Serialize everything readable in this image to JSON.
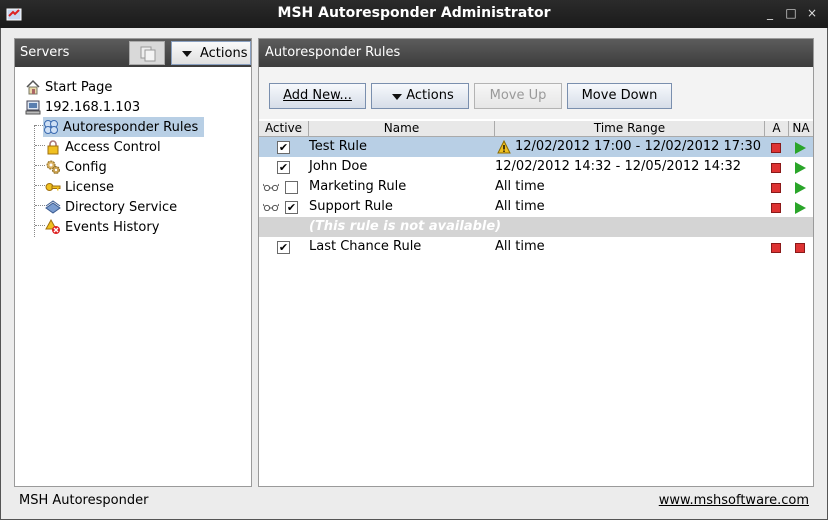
{
  "window": {
    "title": "MSH Autoresponder Administrator",
    "controls": [
      "_",
      "□",
      "×"
    ]
  },
  "servers_panel": {
    "title": "Servers",
    "actions_label": "Actions",
    "tree": [
      {
        "label": "Start Page",
        "icon": "home-icon"
      },
      {
        "label": "192.168.1.103",
        "icon": "computer-icon"
      },
      {
        "label": "Autoresponder Rules",
        "icon": "rules-icon",
        "selected": true
      },
      {
        "label": "Access Control",
        "icon": "lock-icon"
      },
      {
        "label": "Config",
        "icon": "gear-icon"
      },
      {
        "label": "License",
        "icon": "key-icon"
      },
      {
        "label": "Directory Service",
        "icon": "directory-icon"
      },
      {
        "label": "Events History",
        "icon": "events-icon"
      }
    ]
  },
  "rules_panel": {
    "title": "Autoresponder Rules",
    "buttons": {
      "add_new": "Add New...",
      "actions": "Actions",
      "move_up": "Move Up",
      "move_down": "Move Down"
    },
    "columns": [
      "Active",
      "Name",
      "Time Range",
      "A",
      "NA"
    ],
    "rows": [
      {
        "active": "✔",
        "name": "Test Rule",
        "time": "12/02/2012 17:00 - 12/02/2012 17:30",
        "warning": true,
        "selected": true
      },
      {
        "active": "✔",
        "name": "John Doe",
        "time": "12/02/2012 14:32 - 12/05/2012 14:32"
      },
      {
        "active": "",
        "name": "Marketing Rule",
        "time": "All time",
        "glasses": true
      },
      {
        "active": "✔",
        "name": "Support Rule",
        "time": "All time",
        "glasses": true
      },
      {
        "unavailable_text": "(This rule is not available)"
      },
      {
        "active": "✔",
        "name": "Last Chance Rule",
        "time": "All time"
      }
    ]
  },
  "statusbar": {
    "left": "MSH Autoresponder",
    "right": "www.mshsoftware.com"
  },
  "colors": {
    "selection": "#b8cfe5",
    "panel_header": "#4a4a4a",
    "stop": "#dd3333",
    "play": "#2aa52a"
  }
}
